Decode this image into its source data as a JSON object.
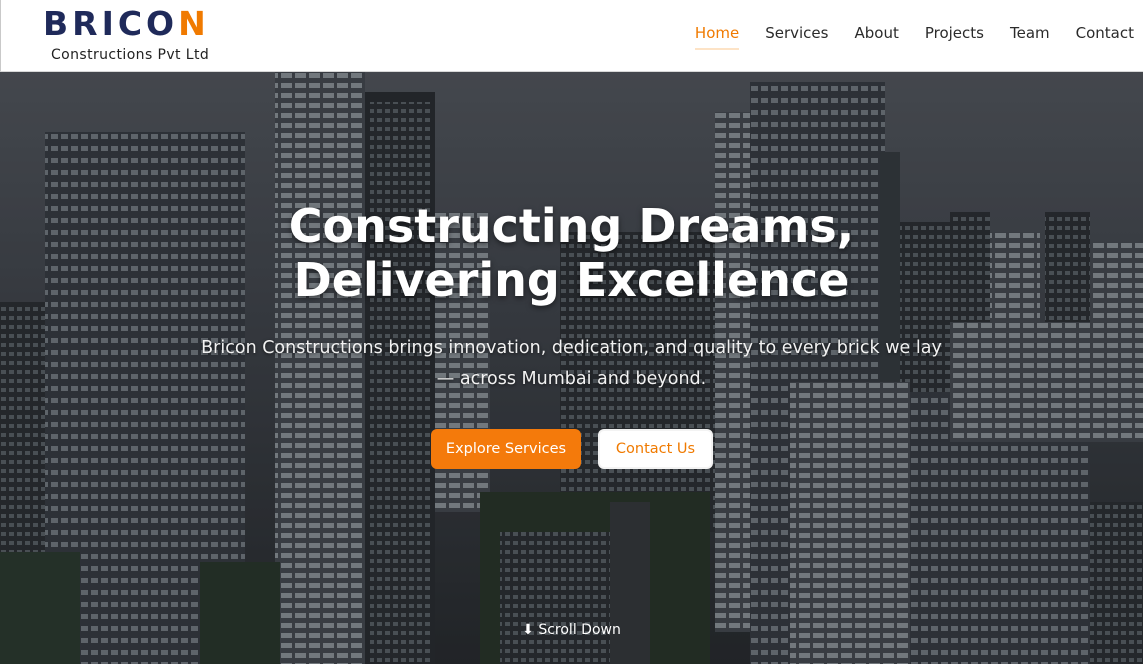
{
  "brand": {
    "name_main": "BRICO",
    "name_accent": "N",
    "subtitle": "Constructions Pvt Ltd",
    "primary_color": "#1f2a5a",
    "accent_color": "#f07a00"
  },
  "nav": {
    "items": [
      {
        "label": "Home",
        "active": true
      },
      {
        "label": "Services",
        "active": false
      },
      {
        "label": "About",
        "active": false
      },
      {
        "label": "Projects",
        "active": false
      },
      {
        "label": "Team",
        "active": false
      },
      {
        "label": "Contact",
        "active": false
      }
    ]
  },
  "hero": {
    "title_line1": "Constructing Dreams,",
    "title_line2": "Delivering Excellence",
    "subtitle_line1": "Bricon Constructions brings innovation, dedication, and quality to every brick we lay",
    "subtitle_line2": "— across Mumbai and beyond.",
    "primary_button": "Explore Services",
    "secondary_button": "Contact Us",
    "scroll_label": "⬇ Scroll Down",
    "background_image": "city-skyline-photo"
  }
}
